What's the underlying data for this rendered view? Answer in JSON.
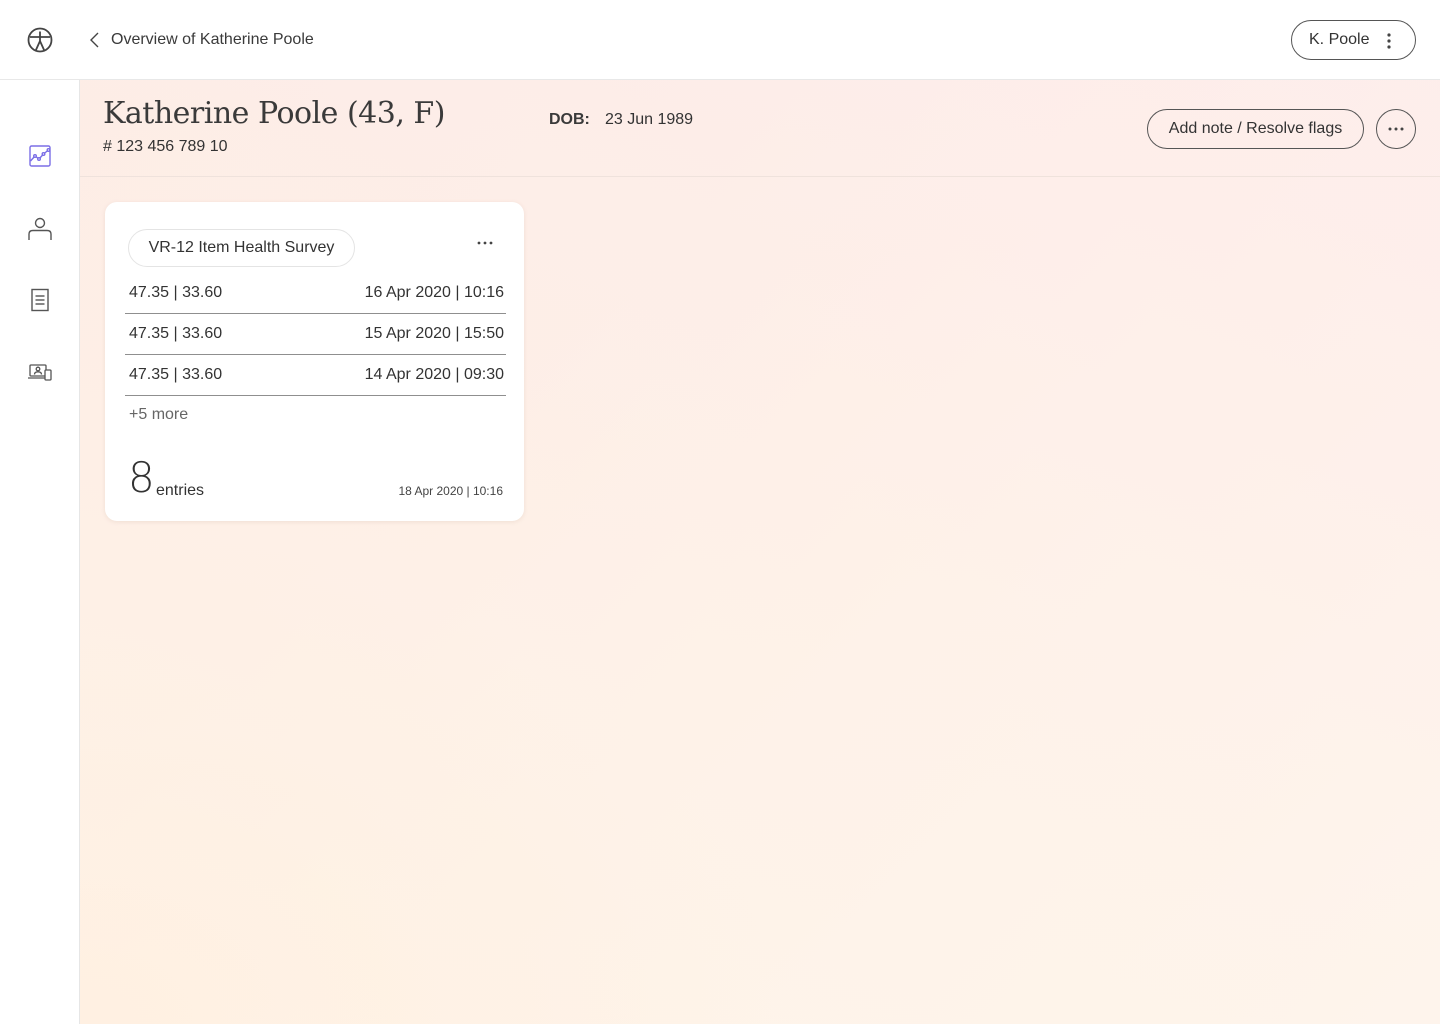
{
  "topbar": {
    "logo_icon": "vitruvian-logo-icon",
    "back_icon": "chevron-left-icon",
    "back_label": "Overview of Katherine Poole",
    "user_label": "K. Poole",
    "user_menu_icon": "kebab-vertical-icon"
  },
  "sidebar": {
    "items": [
      {
        "icon": "chart-icon",
        "label": "Charts",
        "active": true
      },
      {
        "icon": "person-icon",
        "label": "Profile",
        "active": false
      },
      {
        "icon": "document-icon",
        "label": "Documents",
        "active": false
      },
      {
        "icon": "devices-icon",
        "label": "Devices",
        "active": false
      }
    ],
    "accent_color": "#7b6ee6"
  },
  "patient": {
    "name": "Katherine Poole (43, F)",
    "id": "# 123 456 789 10",
    "dob_label": "DOB:",
    "dob_value": "23 Jun 1989",
    "add_note_label": "Add note / Resolve flags",
    "more_icon": "ellipsis-horizontal-icon"
  },
  "card": {
    "title": "VR-12 Item Health Survey",
    "menu_icon": "ellipsis-horizontal-icon",
    "entries": [
      {
        "value": "47.35 | 33.60",
        "timestamp": "16 Apr 2020 | 10:16"
      },
      {
        "value": "47.35 | 33.60",
        "timestamp": "15 Apr 2020 | 15:50"
      },
      {
        "value": "47.35 | 33.60",
        "timestamp": "14 Apr 2020 | 09:30"
      }
    ],
    "more_label": "+5 more",
    "count": "8",
    "count_label": "entries",
    "last_updated": "18 Apr 2020 | 10:16"
  }
}
